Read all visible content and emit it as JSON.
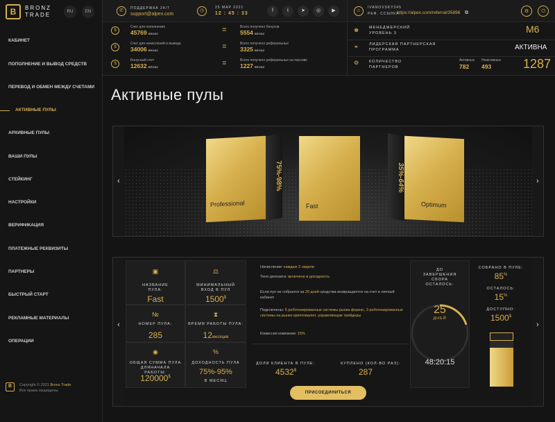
{
  "brand": {
    "logo_letter": "B",
    "name": "BRONZ TRADE",
    "lang_ru": "RU",
    "lang_en": "EN"
  },
  "menu": [
    "КАБИНЕТ",
    "ПОПОЛНЕНИЕ И ВЫВОД СРЕДСТВ",
    "ПЕРЕВОД И ОБМЕН МЕЖДУ СЧЕТАМИ",
    "АКТИВНЫЕ ПУЛЫ",
    "АРХИВНЫЕ ПУЛЫ",
    "ВАШИ ПУЛЫ",
    "СТЕЙКИНГ",
    "НАСТРОЙКИ",
    "ВЕРИФИКАЦИЯ",
    "ПЛАТЕЖНЫЕ РЕКВИЗИТЫ",
    "ПАРТНЕРЫ",
    "БЫСТРЫЙ СТАРТ",
    "РЕКЛАМНЫЕ МАТЕРИАЛЫ",
    "ОПЕРАЦИИ"
  ],
  "copyright": {
    "line1": "Copyright © 2021",
    "brand": "Bronz Trade",
    "line2": "Все права защищены."
  },
  "header": {
    "support_label": "ПОДДЕРЖКА 24/7",
    "support_email": "support@alpex.com",
    "date": "25 МАР 2021",
    "time": "12 : 45 : 33",
    "username": "IVANOVSKY345",
    "ref_label": "РЕФ. ССЫЛКА:",
    "ref_link": "https://alpex.com/referral/35896"
  },
  "stats": {
    "deposit_label": "Счет для пополнения",
    "deposit_value": "45769",
    "deposit_unit": "BRONZ",
    "accrual_label": "Счет для начислений и вывода",
    "accrual_value": "34006",
    "accrual_unit": "BRONZ",
    "bonus_label": "Бонусный счет",
    "bonus_value": "12632",
    "bonus_unit": "BRONZ",
    "total_bonus_label": "Всего получено бонусов",
    "total_bonus_value": "5554",
    "total_bonus_unit": "BRONZ",
    "total_ref_label": "Всего получено реферальных",
    "total_ref_value": "3325",
    "total_ref_unit": "BRONZ",
    "total_passive_label": "Всего получено реферальных на пассиве",
    "total_passive_value": "1227",
    "total_passive_unit": "BRONZ"
  },
  "right": {
    "manager_label1": "МЕНЕДЖЕРСКИЙ",
    "manager_label2": "УРОВЕНЬ 3",
    "manager_value": "M6",
    "leader_label1": "ЛИДЕРСКАЯ ПАРТНЕРСКАЯ",
    "leader_label2": "ПРОГРАММА",
    "leader_value": "АКТИВНА",
    "partners_label1": "КОЛИЧЕСТВО",
    "partners_label2": "ПАРТНЕРОВ",
    "active_label": "Активных",
    "active_value": "782",
    "inactive_label": "Неактивных",
    "inactive_value": "493",
    "partners_total": "1287"
  },
  "page_title": "Активные пулы",
  "carousel": {
    "left_box_label": "Professional",
    "left_box_side": "75%-98%",
    "center_box_label": "Fast",
    "right_box_label": "Optimum",
    "right_box_side": "35%-64%"
  },
  "pool": {
    "name_label": "НАЗВАНИЕ ПУЛА:",
    "name_value": "Fast",
    "min_label": "МИНИМАЛЬНЫЙ ВХОД В ПУЛ",
    "min_value": "1500",
    "min_unit": "$",
    "number_label": "НОМЕР ПУЛА:",
    "number_value": "285",
    "runtime_label": "ВРЕМЯ РАБОТЫ ПУЛА:",
    "runtime_value": "12",
    "runtime_unit": "месяцев",
    "total_label": "ОБЩАЯ СУММА ПУЛА ДЛЯНАЧАЛА РАБОТЫ:",
    "total_value": "120000",
    "total_unit": "$",
    "yield_label": "ДОХОДНОСТЬ ПУЛА",
    "yield_value": "75%-95%",
    "yield_sub": "В МЕСЯЦ",
    "accrual_text": "Начисление:",
    "accrual_hl": "каждые 2 недели",
    "body_text": "Тело депозита:",
    "body_hl": "включено в доходность",
    "notfilled_text1": "Если пул не собрался за",
    "notfilled_hl": "20 дней",
    "notfilled_text2": "средства возвращаются на счет в личный кабинет",
    "connected_text": "Подключены:",
    "connected_hl": "5 роботизированные системы рынка форекс, 3 роботизированные системы на рынке криптовалют, управляющие трейдеры",
    "fee_text": "Комиссия компании:",
    "fee_hl": "15%",
    "client_share_label": "ДОЛЯ КЛИЕНТА В ПУЛЕ:",
    "client_share_value": "4532",
    "client_share_unit": "$",
    "bought_label": "КУПЛЕНО (КОЛ-ВО РАЗ):",
    "bought_value": "287",
    "countdown_label": "ДО ЗАВЕРШЕНИЯ СБОРА ОСТАЛОСЬ:",
    "days_value": "25",
    "days_label": "ДНЕЙ",
    "countdown_time": "48:20:15",
    "collected_label": "СОБРАНО В ПУЛЕ:",
    "collected_value": "85",
    "collected_unit": "%",
    "remaining_label": "ОСТАЛОСЬ:",
    "remaining_value": "15",
    "remaining_unit": "%",
    "available_label": "ДОСТУПНО:",
    "available_value": "1500",
    "available_unit": "$",
    "join_button": "ПРИСОЕДИНИТЬСЯ",
    "countdown_progress": 0.2,
    "collected_fill": 0.85
  },
  "colors": {
    "accent": "#d8b150",
    "bg": "#141414"
  },
  "icons": [
    "support-icon",
    "clock-icon",
    "facebook-icon",
    "twitter-icon",
    "telegram-icon",
    "instagram-icon",
    "youtube-icon",
    "user-icon",
    "gear-icon",
    "power-icon",
    "copy-icon"
  ]
}
